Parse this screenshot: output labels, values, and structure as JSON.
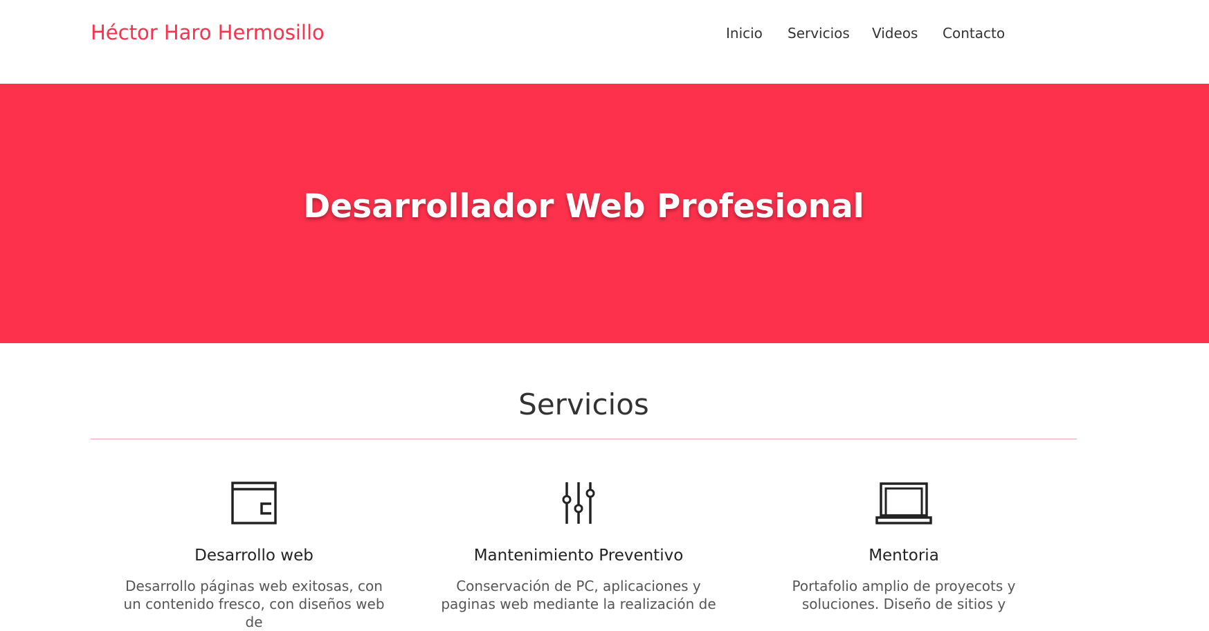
{
  "brand": "Héctor Haro Hermosillo",
  "nav": {
    "items": [
      {
        "label": "Inicio"
      },
      {
        "label": "Servicios"
      },
      {
        "label": "Videos"
      },
      {
        "label": "Contacto"
      }
    ]
  },
  "hero": {
    "title": "Desarrollador Web Profesional",
    "background_color": "#fe314d"
  },
  "services": {
    "title": "Servicios",
    "items": [
      {
        "icon": "wallet-icon",
        "title": "Desarrollo web",
        "text": "Desarrollo páginas web exitosas, con un contenido fresco, con diseños web de"
      },
      {
        "icon": "sliders-icon",
        "title": "Mantenimiento Preventivo",
        "text": "Conservación de PC, aplicaciones y paginas web mediante la realización de"
      },
      {
        "icon": "laptop-icon",
        "title": "Mentoria",
        "text": "Portafolio amplio de proyecots y soluciones. Diseño de sitios y"
      }
    ]
  },
  "colors": {
    "accent": "#fe314d",
    "text_dark": "#333333",
    "divider": "#f2a3ae"
  }
}
